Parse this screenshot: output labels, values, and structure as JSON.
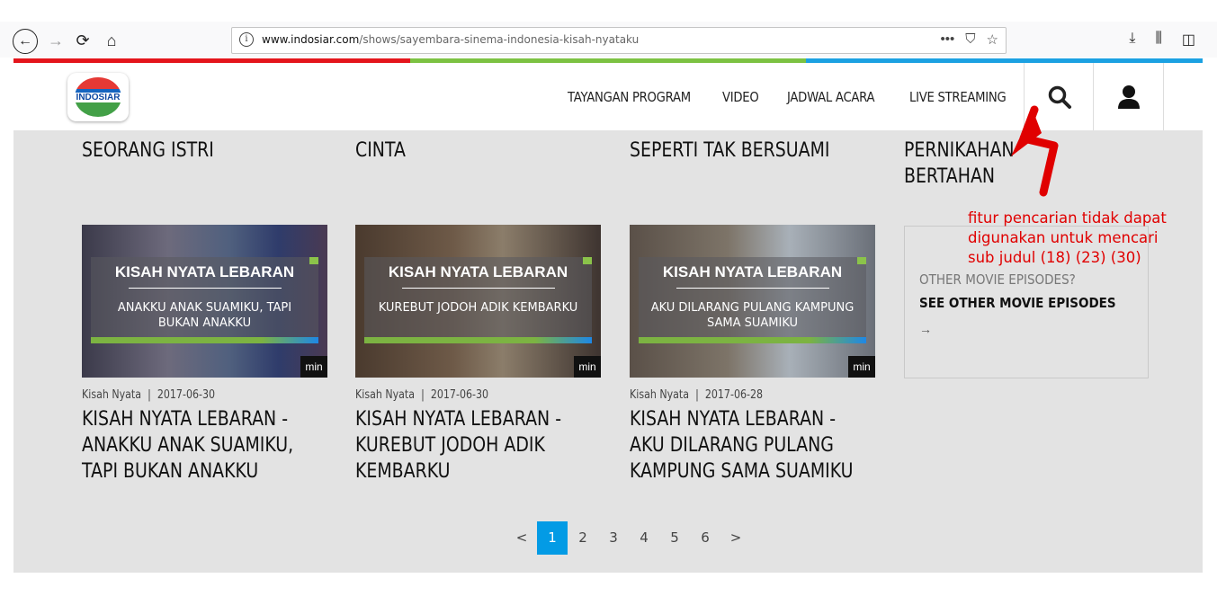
{
  "browser": {
    "url_domain": "www.indosiar.com",
    "url_path": "/shows/sayembara-sinema-indonesia-kisah-nyataku"
  },
  "colors": {
    "stripe": [
      "#e4151c",
      "#7cc242",
      "#1ba1e2"
    ],
    "annotation": "#e00000",
    "active_page": "#039be5",
    "content_bg": "#e3e3e3"
  },
  "site": {
    "logo_text": "INDOSIAR",
    "nav": [
      "TAYANGAN PROGRAM",
      "VIDEO",
      "JADWAL ACARA",
      "LIVE STREAMING"
    ]
  },
  "top_titles": [
    {
      "line1": "SEORANG ISTRI"
    },
    {
      "line1": "CINTA"
    },
    {
      "line1": "SEPERTI TAK BERSUAMI"
    },
    {
      "line1": "PERNIKAHAN",
      "line2": "BERTAHAN"
    }
  ],
  "cards": [
    {
      "thumb_title": "KISAH NYATA LEBARAN",
      "thumb_subtitle": "ANAKKU ANAK SUAMIKU, TAPI BUKAN ANAKKU",
      "badge": "min",
      "category": "Kisah Nyata",
      "date": "2017-06-30",
      "title_lines": [
        "KISAH NYATA LEBARAN -",
        "ANAKKU ANAK SUAMIKU,",
        "TAPI BUKAN ANAKKU"
      ]
    },
    {
      "thumb_title": "KISAH NYATA LEBARAN",
      "thumb_subtitle": "KUREBUT JODOH ADIK KEMBARKU",
      "badge": "min",
      "category": "Kisah Nyata",
      "date": "2017-06-30",
      "title_lines": [
        "KISAH NYATA LEBARAN -",
        "KUREBUT JODOH ADIK",
        "KEMBARKU"
      ]
    },
    {
      "thumb_title": "KISAH NYATA LEBARAN",
      "thumb_subtitle": "AKU DILARANG PULANG KAMPUNG SAMA SUAMIKU",
      "badge": "min",
      "category": "Kisah Nyata",
      "date": "2017-06-28",
      "title_lines": [
        "KISAH NYATA LEBARAN -",
        "AKU DILARANG PULANG",
        "KAMPUNG SAMA SUAMIKU"
      ]
    }
  ],
  "meta_separator": "|",
  "other_box": {
    "question": "OTHER MOVIE EPISODES?",
    "link": "SEE OTHER MOVIE EPISODES",
    "arrow": "→"
  },
  "annotation": {
    "lines": [
      "fitur pencarian tidak dapat",
      "digunakan untuk mencari",
      "sub judul (18) (23) (30)"
    ]
  },
  "pagination": {
    "prev": "<",
    "pages": [
      "1",
      "2",
      "3",
      "4",
      "5",
      "6"
    ],
    "active": "1",
    "next": ">"
  }
}
